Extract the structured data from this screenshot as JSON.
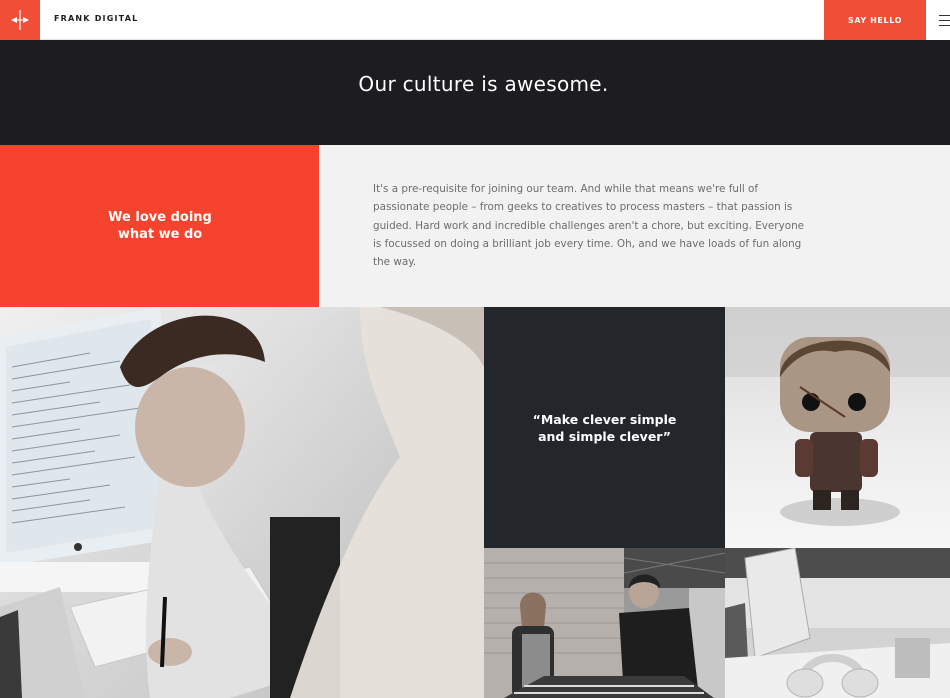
{
  "header": {
    "brand": "FRANK DIGITAL",
    "cta_label": "SAY HELLO",
    "logo_icon": "frank-logo-icon",
    "menu_icon": "hamburger-menu-icon"
  },
  "hero": {
    "title": "Our culture is awesome."
  },
  "intro": {
    "heading_line1": "We love doing",
    "heading_line2": "what we do",
    "body": "It's a pre-requisite for joining our team. And while that means we're full of passionate people – from geeks to creatives to process masters – that passion is guided. Hard work and incredible challenges aren't a chore, but exciting. Everyone is focussed on doing a brilliant job every time. Oh, and we have loads of fun along the way."
  },
  "quote": {
    "line1": "“Make clever simple",
    "line2": "and simple clever”"
  },
  "colors": {
    "accent": "#f04e37",
    "dark": "#1d1d20",
    "quote_bg": "#23262b",
    "copy_bg": "#f2f2f2"
  }
}
